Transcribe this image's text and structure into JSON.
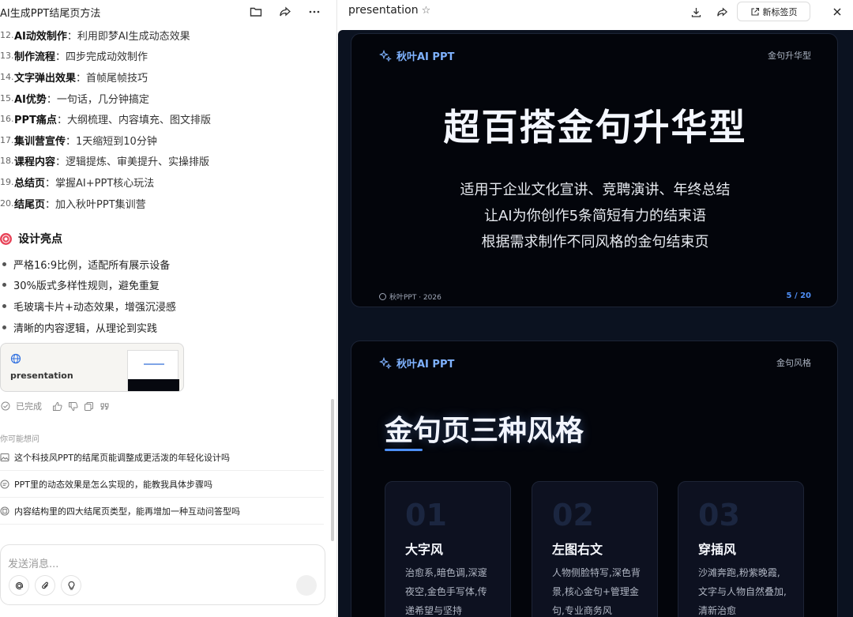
{
  "left": {
    "title": "AI生成PPT结尾页方法",
    "steps": [
      {
        "num": "12.",
        "bold": "AI动效制作",
        "rest": "：利用即梦AI生成动态效果"
      },
      {
        "num": "13.",
        "bold": "制作流程",
        "rest": "：四步完成动效制作"
      },
      {
        "num": "14.",
        "bold": "文字弹出效果",
        "rest": "：首帧尾帧技巧"
      },
      {
        "num": "15.",
        "bold": "AI优势",
        "rest": "：一句话，几分钟搞定"
      },
      {
        "num": "16.",
        "bold": "PPT痛点",
        "rest": "：大纲梳理、内容填充、图文排版"
      },
      {
        "num": "17.",
        "bold": "集训营宣传",
        "rest": "：1天缩短到10分钟"
      },
      {
        "num": "18.",
        "bold": "课程内容",
        "rest": "：逻辑提炼、审美提升、实操排版"
      },
      {
        "num": "19.",
        "bold": "总结页",
        "rest": "：掌握AI+PPT核心玩法"
      },
      {
        "num": "20.",
        "bold": "结尾页",
        "rest": "：加入秋叶PPT集训营"
      }
    ],
    "highlights_title": "设计亮点",
    "bullets": [
      "严格16:9比例，适配所有展示设备",
      "30%版式多样性规则，避免重复",
      "毛玻璃卡片+动态效果，增强沉浸感",
      "清晰的内容逻辑，从理论到实践"
    ],
    "card_label": "presentation",
    "status": "已完成",
    "maybe_ask": "你可能想问",
    "suggestions": [
      "这个科技风PPT的结尾页能调整成更活泼的年轻化设计吗",
      "PPT里的动态效果是怎么实现的，能教我具体步骤吗",
      "内容结构里的四大结尾页类型，能再增加一种互动问答型吗"
    ],
    "input_placeholder": "发送消息..."
  },
  "right": {
    "title": "presentation",
    "new_tab": "新标签页",
    "slide1": {
      "brand": "秋叶AI PPT",
      "tag": "金句升华型",
      "title": "超百搭金句升华型",
      "lines": [
        "适用于企业文化宣讲、竞聘演讲、年终总结",
        "让AI为你创作5条简短有力的结束语",
        "根据需求制作不同风格的金句结束页"
      ],
      "footer": "秋叶PPT · 2026",
      "page": "5 / 20"
    },
    "slide2": {
      "brand": "秋叶AI PPT",
      "tag": "金句风格",
      "title": "金句页三种风格",
      "cards": [
        {
          "n": "01",
          "t": "大字风",
          "d": "治愈系,暗色调,深邃夜空,金色手写体,传递希望与坚持"
        },
        {
          "n": "02",
          "t": "左图右文",
          "d": "人物侧脸特写,深色背景,核心金句+管理金句,专业商务风"
        },
        {
          "n": "03",
          "t": "穿插风",
          "d": "沙滩奔跑,粉紫晚霞,文字与人物自然叠加,清新治愈"
        }
      ]
    }
  },
  "colors": {
    "accent": "#4f8ff7",
    "brand_text": "#7fb2ff",
    "slide_bg": "#03050b",
    "stage_bg": "#0b1220"
  }
}
